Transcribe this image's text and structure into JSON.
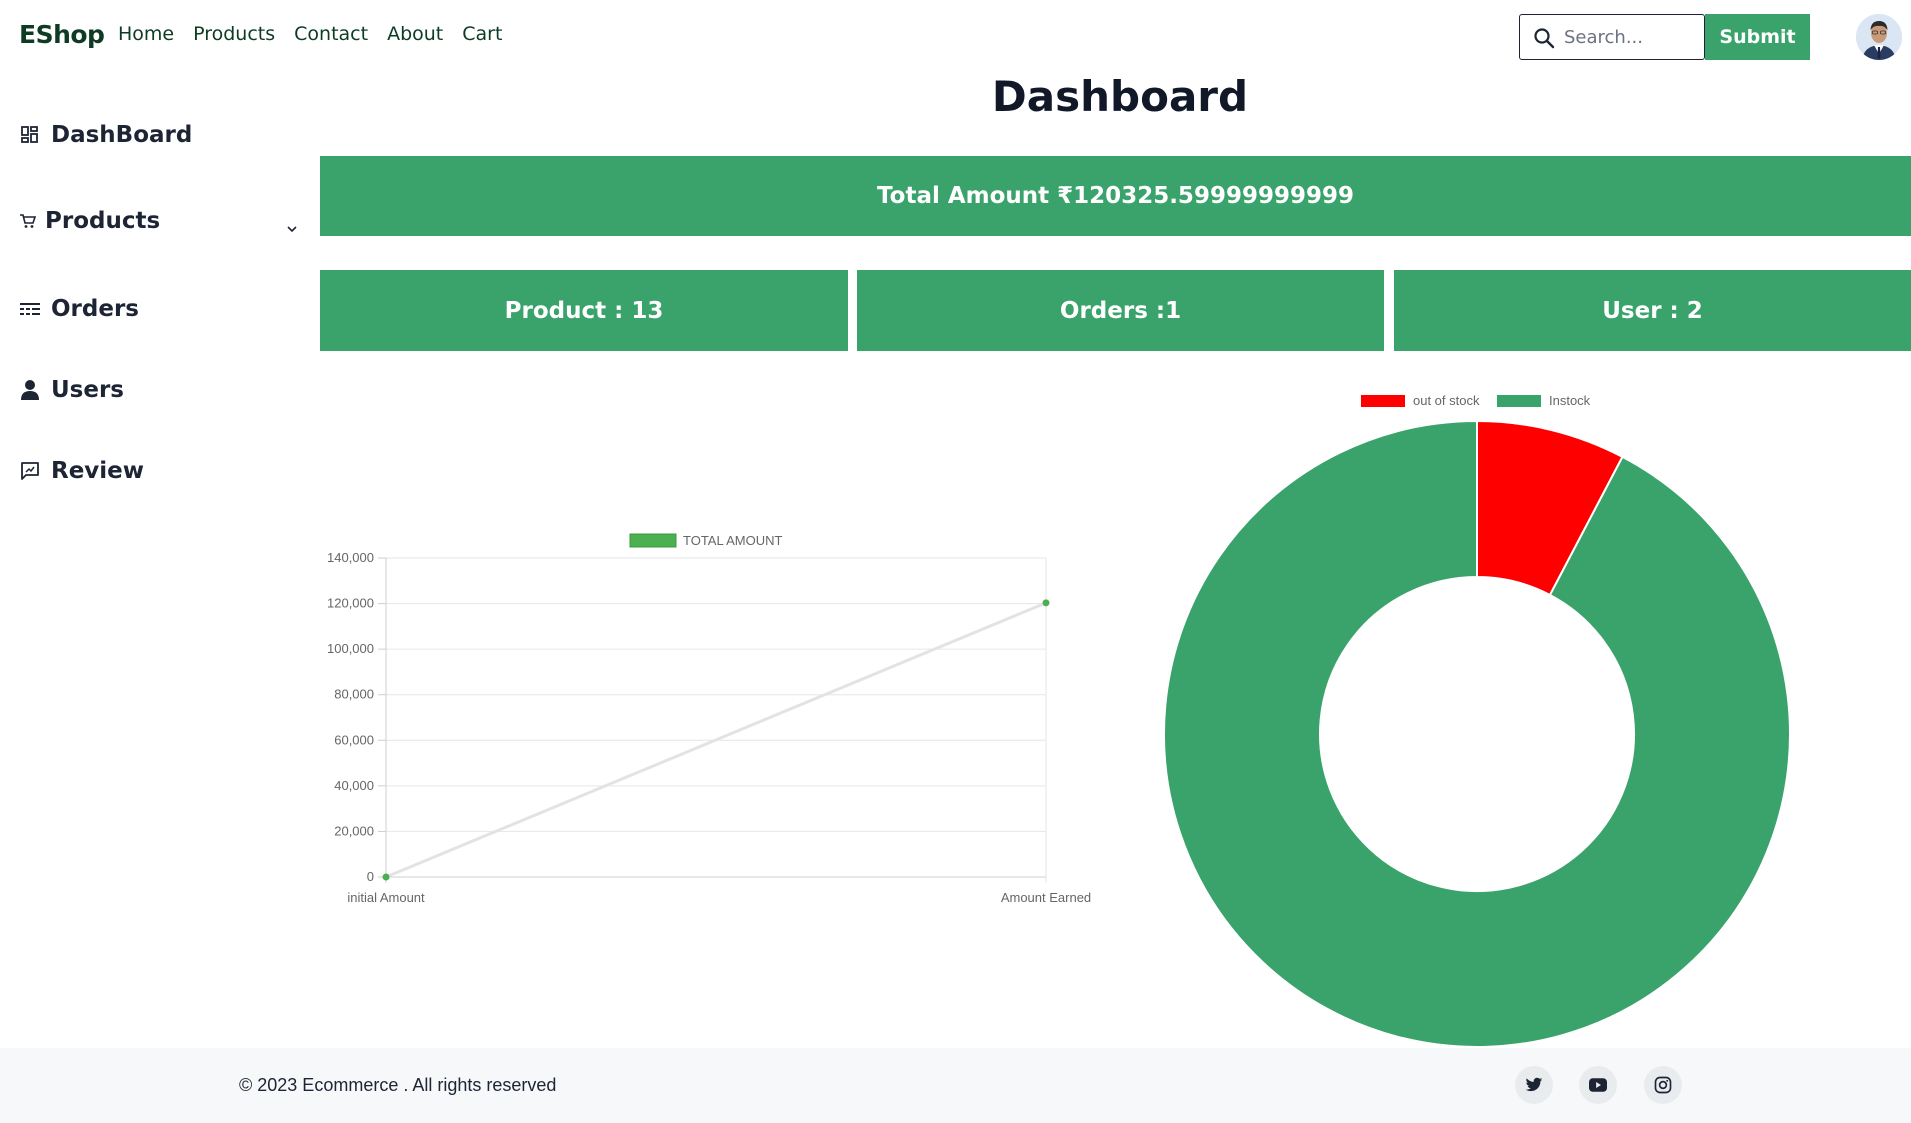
{
  "navbar": {
    "brand": "EShop",
    "links": [
      "Home",
      "Products",
      "Contact",
      "About",
      "Cart"
    ],
    "search_placeholder": "Search...",
    "submit_label": "Submit"
  },
  "sidebar": {
    "items": [
      {
        "label": "DashBoard",
        "icon": "dashboard-icon"
      },
      {
        "label": "Products",
        "icon": "cart-icon"
      },
      {
        "label": "Orders",
        "icon": "orders-icon"
      },
      {
        "label": "Users",
        "icon": "user-icon"
      },
      {
        "label": "Review",
        "icon": "review-icon"
      }
    ]
  },
  "main": {
    "title": "Dashboard",
    "total_amount": "Total Amount ₹120325.59999999999",
    "stats": {
      "product": "Product : 13",
      "orders": "Orders :1",
      "users": "User : 2"
    }
  },
  "chart_data": [
    {
      "type": "line",
      "categories": [
        "initial Amount",
        "Amount Earned"
      ],
      "series": [
        {
          "name": "TOTAL AMOUNT",
          "values": [
            0,
            120325.59999999999
          ],
          "color": "#4caf50"
        }
      ],
      "yticks": [
        "0",
        "20,000",
        "40,000",
        "60,000",
        "80,000",
        "100,000",
        "120,000",
        "140,000"
      ],
      "ylim": [
        0,
        140000
      ],
      "legend": "top",
      "grid": true
    },
    {
      "type": "pie",
      "variant": "doughnut",
      "categories": [
        "out of stock",
        "Instock"
      ],
      "values": [
        1,
        12
      ],
      "colors": [
        "#ff0000",
        "#3aa36b"
      ],
      "legend": "top"
    }
  ],
  "footer": {
    "copyright": "© 2023 Ecommerce . All rights reserved",
    "social": [
      "twitter-icon",
      "youtube-icon",
      "instagram-icon"
    ]
  }
}
